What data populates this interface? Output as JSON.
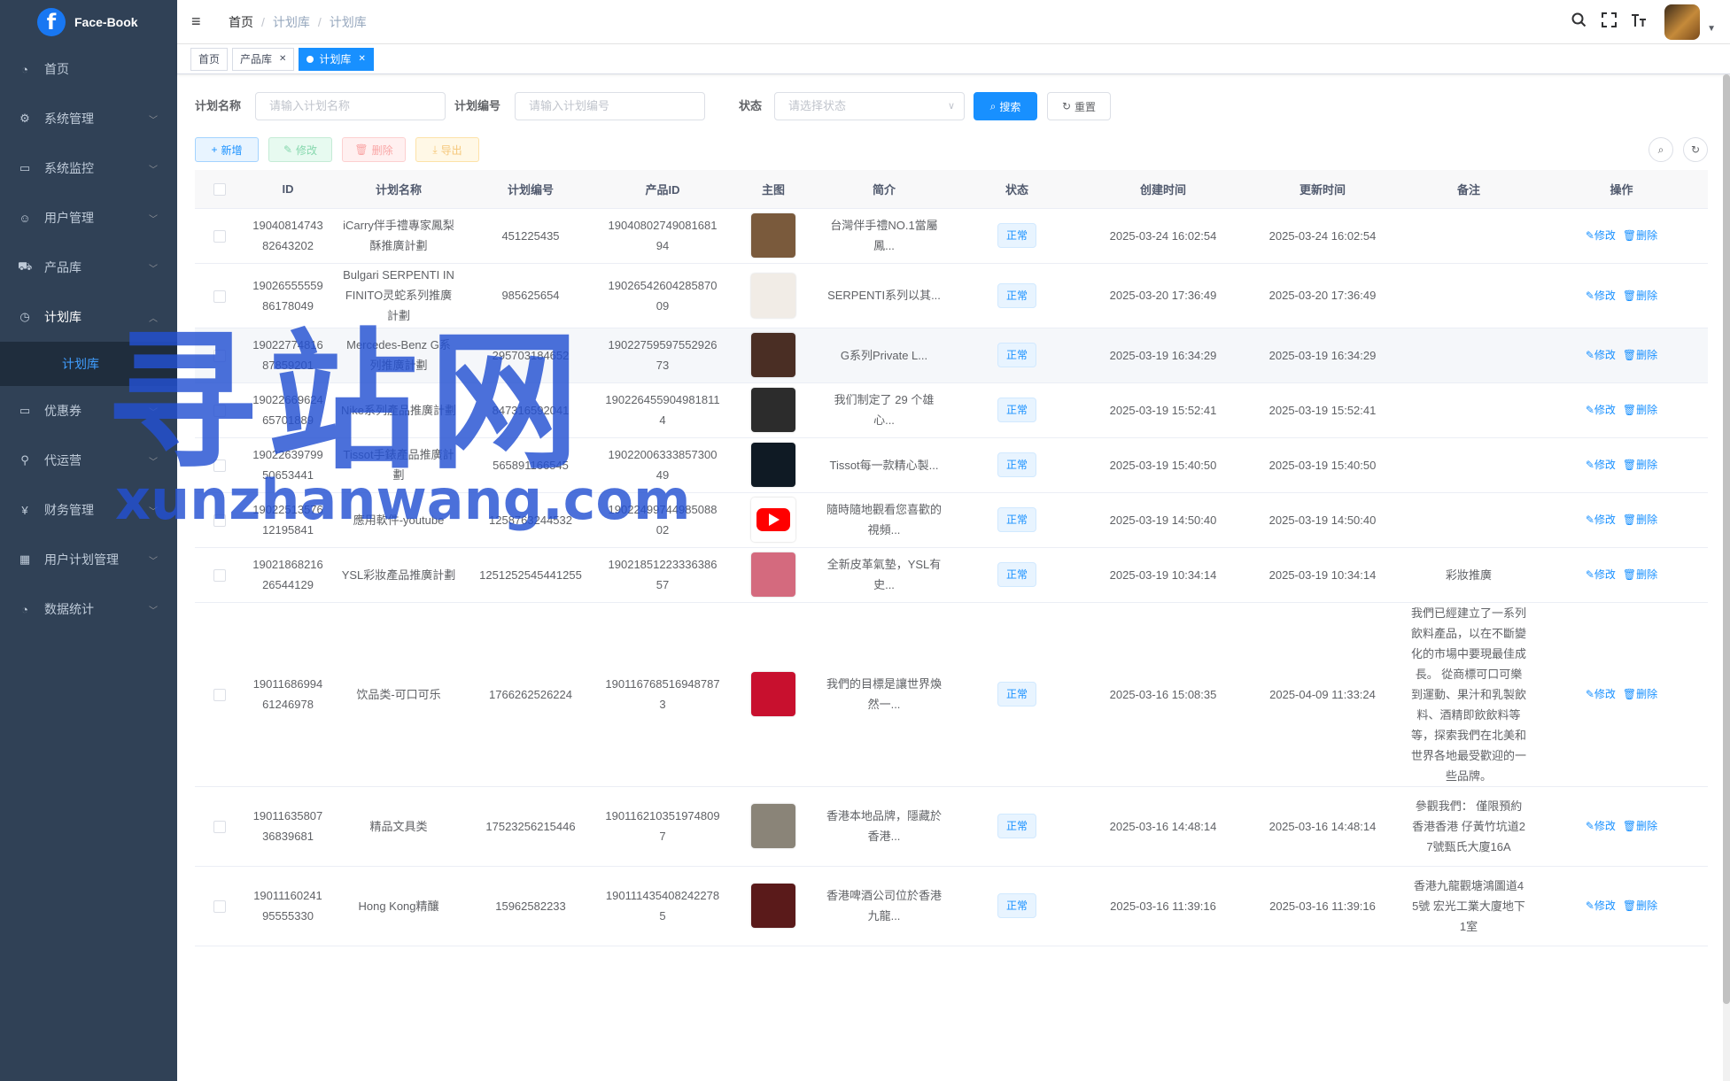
{
  "app": {
    "logo_letter": "f",
    "name": "Face-Book"
  },
  "sidebar": {
    "items": [
      {
        "icon": "dashboard-icon",
        "glyph": "◔",
        "label": "首页",
        "has_children": false
      },
      {
        "icon": "gear-icon",
        "glyph": "⚙",
        "label": "系统管理",
        "has_children": true
      },
      {
        "icon": "monitor-icon",
        "glyph": "▭",
        "label": "系统监控",
        "has_children": true
      },
      {
        "icon": "user-icon",
        "glyph": "☺",
        "label": "用户管理",
        "has_children": true
      },
      {
        "icon": "cart-icon",
        "glyph": "⛟",
        "label": "产品库",
        "has_children": true
      },
      {
        "icon": "clock-icon",
        "glyph": "◷",
        "label": "计划库",
        "has_children": true,
        "open": true
      },
      {
        "icon": "coupon-icon",
        "glyph": "▭",
        "label": "优惠券",
        "has_children": true
      },
      {
        "icon": "agent-icon",
        "glyph": "⚲",
        "label": "代运营",
        "has_children": true
      },
      {
        "icon": "yen-icon",
        "glyph": "¥",
        "label": "财务管理",
        "has_children": true
      },
      {
        "icon": "grid-icon",
        "glyph": "▦",
        "label": "用户计划管理",
        "has_children": true
      },
      {
        "icon": "chart-icon",
        "glyph": "◔",
        "label": "数据统计",
        "has_children": true
      }
    ],
    "active_sub": "计划库"
  },
  "navbar": {
    "breadcrumb": [
      "首页",
      "计划库",
      "计划库"
    ]
  },
  "tags": [
    {
      "label": "首页",
      "closable": false,
      "active": false
    },
    {
      "label": "产品库",
      "closable": true,
      "active": false
    },
    {
      "label": "计划库",
      "closable": true,
      "active": true
    }
  ],
  "search": {
    "plan_name_label": "计划名称",
    "plan_name_placeholder": "请输入计划名称",
    "plan_no_label": "计划编号",
    "plan_no_placeholder": "请输入计划编号",
    "status_label": "状态",
    "status_placeholder": "请选择状态",
    "search_btn": "搜索",
    "reset_btn": "重置"
  },
  "toolbar": {
    "add": "新增",
    "edit": "修改",
    "delete": "删除",
    "export": "导出"
  },
  "table": {
    "columns": [
      "ID",
      "计划名称",
      "计划编号",
      "产品ID",
      "主图",
      "简介",
      "状态",
      "创建时间",
      "更新时间",
      "备注",
      "操作"
    ],
    "op_edit": "修改",
    "op_delete": "删除",
    "rows": [
      {
        "id": "1904081474382643202",
        "name": "iCarry伴手禮專家鳳梨酥推廣計劃",
        "no": "451225435",
        "pid": "1904080274908168194",
        "intro": "台灣伴手禮NO.1當屬鳳...",
        "status": "正常",
        "created": "2025-03-24 16:02:54",
        "updated": "2025-03-24 16:02:54",
        "remark": "",
        "thumb": "#7a5a3c"
      },
      {
        "id": "1902655555986178049",
        "name": "Bulgari SERPENTI INFINITO灵蛇系列推廣計劃",
        "no": "985625654",
        "pid": "1902654260428587009",
        "intro": "SERPENTI系列以其...",
        "status": "正常",
        "created": "2025-03-20 17:36:49",
        "updated": "2025-03-20 17:36:49",
        "remark": "",
        "thumb": "#f1ece6"
      },
      {
        "id": "1902277481687859201",
        "name": "Mercedes-Benz G系列推廣計劃",
        "no": "295703184652",
        "pid": "1902275959755292673",
        "intro": "G系列Private L...",
        "status": "正常",
        "created": "2025-03-19 16:34:29",
        "updated": "2025-03-19 16:34:29",
        "remark": "",
        "thumb": "#4a2e24"
      },
      {
        "id": "1902266962465701889",
        "name": "Nike系列產品推廣計劃",
        "no": "847316592041",
        "pid": "1902264559049818114",
        "intro": "我们制定了 29 个雄心...",
        "status": "正常",
        "created": "2025-03-19 15:52:41",
        "updated": "2025-03-19 15:52:41",
        "remark": "",
        "thumb": "#2c2c2c"
      },
      {
        "id": "1902263979950653441",
        "name": "Tissot手錶產品推廣計劃",
        "no": "565891166545",
        "pid": "1902200633385730049",
        "intro": "Tissot每一款精心製...",
        "status": "正常",
        "created": "2025-03-19 15:40:50",
        "updated": "2025-03-19 15:40:50",
        "remark": "",
        "thumb": "#0f1a24"
      },
      {
        "id": "1902251357612195841",
        "name": "應用軟件-youtube",
        "no": "1258763244532",
        "pid": "1902249974498508802",
        "intro": "隨時隨地觀看您喜歡的視頻...",
        "status": "正常",
        "created": "2025-03-19 14:50:40",
        "updated": "2025-03-19 14:50:40",
        "remark": "",
        "thumb": "youtube"
      },
      {
        "id": "1902186821626544129",
        "name": "YSL彩妝產品推廣計劃",
        "no": "1251252545441255",
        "pid": "1902185122333638657",
        "intro": "全新皮革氣墊，YSL有史...",
        "status": "正常",
        "created": "2025-03-19 10:34:14",
        "updated": "2025-03-19 10:34:14",
        "remark": "彩妝推廣",
        "thumb": "#d46a7e"
      },
      {
        "id": "1901168699461246978",
        "name": "饮品类-可口可乐",
        "no": "1766262526224",
        "pid": "1901167685169487873",
        "intro": "我們的目標是讓世界煥然一...",
        "status": "正常",
        "created": "2025-03-16 15:08:35",
        "updated": "2025-04-09 11:33:24",
        "remark": "我們已經建立了一系列飲料產品，以在不斷變化的市場中要現最佳成長。 從商標可口可樂到運動、果汁和乳製飲料、酒精即飲飲料等等，探索我們在北美和世界各地最受歡迎的一些品牌。",
        "thumb": "#c8102e"
      },
      {
        "id": "1901163580736839681",
        "name": "精品文具类",
        "no": "17523256215446",
        "pid": "1901162103519748097",
        "intro": "香港本地品牌，隱藏於香港...",
        "status": "正常",
        "created": "2025-03-16 14:48:14",
        "updated": "2025-03-16 14:48:14",
        "remark": "參觀我們： 僅限預約香港香港 仔黃竹坑道27號甄氏大廈16A",
        "thumb": "#8a8478"
      },
      {
        "id": "1901116024195555330",
        "name": "Hong Kong精釀",
        "no": "15962582233",
        "pid": "1901114354082422785",
        "intro": "香港啤酒公司位於香港九龍...",
        "status": "正常",
        "created": "2025-03-16 11:39:16",
        "updated": "2025-03-16 11:39:16",
        "remark": "香港九龍觀塘鴻圖道45號 宏光工業大廈地下1室",
        "thumb": "#5a1a1a"
      }
    ]
  },
  "watermark": {
    "cn": "寻站网",
    "en": "xunzhanwang.com"
  }
}
